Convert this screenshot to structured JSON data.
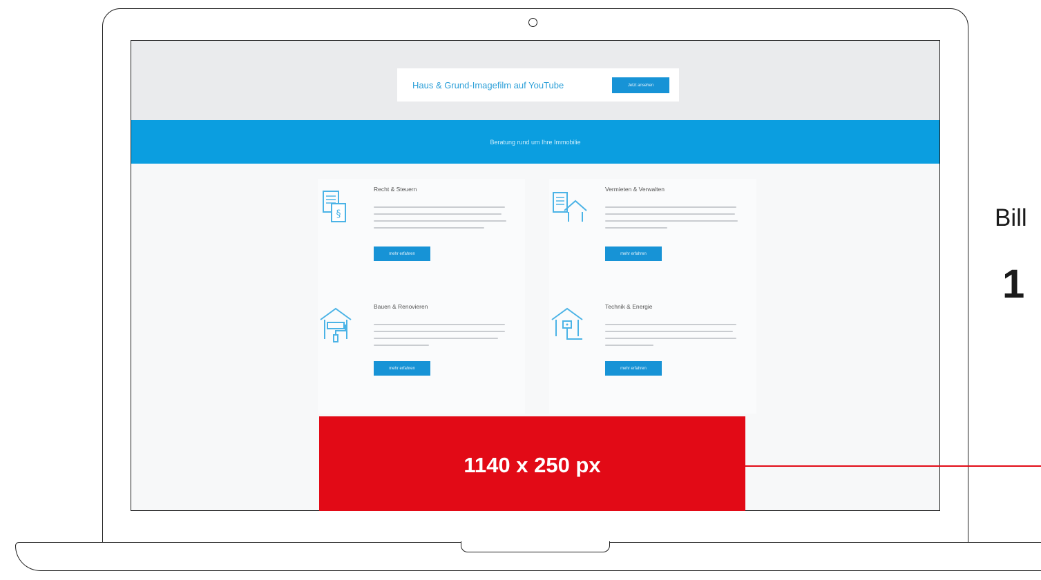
{
  "website": {
    "promo_text": "Haus & Grund-Imagefilm auf YouTube",
    "promo_button": "Jetzt ansehen",
    "band_text": "Beratung rund um Ihre Immobilie",
    "cards": [
      {
        "title": "Recht & Steuern",
        "button": "mehr erfahren",
        "icon": "document-paragraph-icon"
      },
      {
        "title": "Vermieten & Verwalten",
        "button": "mehr erfahren",
        "icon": "document-house-icon"
      },
      {
        "title": "Bauen & Renovieren",
        "button": "mehr erfahren",
        "icon": "house-paint-roller-icon"
      },
      {
        "title": "Technik & Energie",
        "button": "mehr erfahren",
        "icon": "house-plug-icon"
      }
    ]
  },
  "banner": {
    "size_label": "1140 x 250 px",
    "color": "#e20a16"
  },
  "side": {
    "label": "Bill",
    "value": "1"
  },
  "colors": {
    "accent_blue": "#0b9ee0",
    "button_blue": "#1793d6"
  }
}
